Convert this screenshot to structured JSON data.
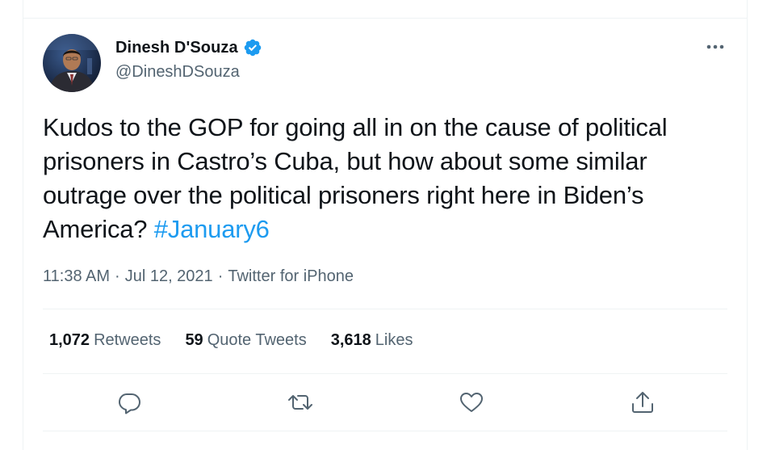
{
  "author": {
    "display_name": "Dinesh D'Souza",
    "handle": "@DineshDSouza",
    "verified": true
  },
  "tweet": {
    "text": "Kudos to the GOP for going all in on the cause of political prisoners in Castro’s Cuba, but how about some similar outrage over the political prisoners right here in Biden’s America? ",
    "hashtag": "#January6"
  },
  "meta": {
    "time": "11:38 AM",
    "separator1": "·",
    "date": "Jul 12, 2021",
    "separator2": "·",
    "source": "Twitter for iPhone"
  },
  "stats": {
    "retweets_count": "1,072",
    "retweets_label": "Retweets",
    "quotes_count": "59",
    "quotes_label": "Quote Tweets",
    "likes_count": "3,618",
    "likes_label": "Likes"
  },
  "icons": {
    "more": "more-icon",
    "verified": "verified-badge-icon",
    "reply": "reply-icon",
    "retweet": "retweet-icon",
    "like": "heart-icon",
    "share": "share-icon"
  },
  "colors": {
    "accent": "#1d9bf0",
    "text_primary": "#0f1419",
    "text_secondary": "#536471",
    "divider": "#eff3f4"
  }
}
